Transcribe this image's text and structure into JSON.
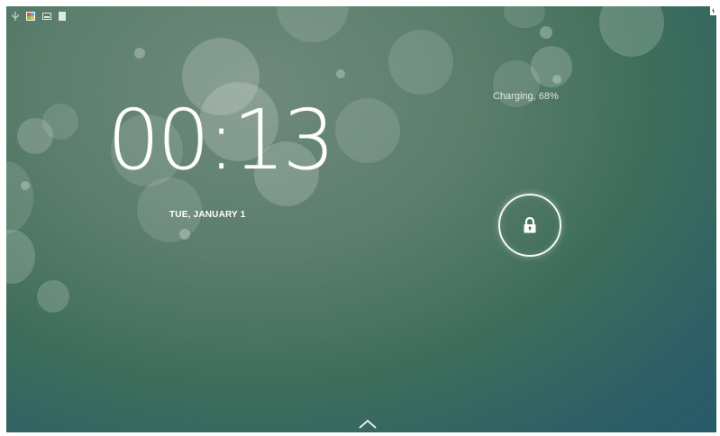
{
  "status_bar": {
    "icons": [
      "usb-debug-icon",
      "gallery-app-icon",
      "screenshot-icon",
      "sd-card-icon"
    ],
    "right_icon": "battery-icon"
  },
  "lockscreen": {
    "time": "00:13",
    "date": "TUE, JANUARY 1",
    "battery_status": "Charging, 68%",
    "lock_icon": "lock-icon",
    "unlock_hint_icon": "chevron-up-icon"
  },
  "colors": {
    "wallpaper_top": "#6f8a7c",
    "wallpaper_bottom": "#275a6a",
    "text": "#ffffff"
  }
}
